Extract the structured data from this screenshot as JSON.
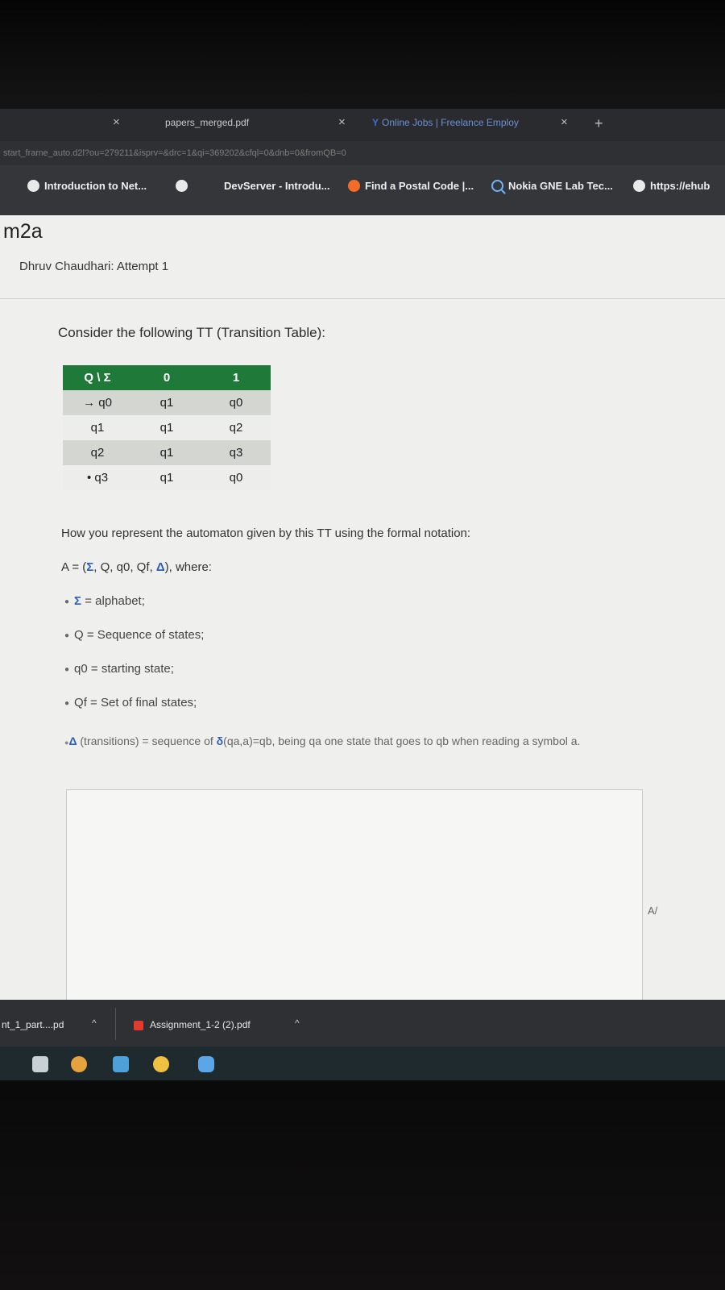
{
  "tabs": {
    "tab1_title": "papers_merged.pdf",
    "tab2_title": "Online Jobs | Freelance Employ",
    "close_glyph": "×",
    "new_tab_glyph": "+"
  },
  "address": {
    "url": "start_frame_auto.d2l?ou=279211&isprv=&drc=1&qi=369202&cfql=0&dnb=0&fromQB=0"
  },
  "bookmarks": [
    {
      "label": "Introduction to Net..."
    },
    {
      "label": "DevServer - Introdu..."
    },
    {
      "label": "Find a Postal Code |..."
    },
    {
      "label": "Nokia GNE Lab Tec..."
    },
    {
      "label": "https://ehub"
    }
  ],
  "page": {
    "course_title": "m2a",
    "attempt_label": "Dhruv Chaudhari: Attempt 1",
    "question_text": "Consider the following TT (Transition Table):",
    "table": {
      "header": [
        "Q \\ Σ",
        "0",
        "1"
      ],
      "rows": [
        [
          "→ q0",
          "q1",
          "q0"
        ],
        [
          "q1",
          "q1",
          "q2"
        ],
        [
          "q2",
          "q1",
          "q3"
        ],
        [
          "• q3",
          "q1",
          "q0"
        ]
      ]
    },
    "prompt": "How you represent the automaton given by this TT using the formal notation:",
    "formal_prefix": "A = (",
    "formal_sigma": "Σ",
    "formal_middle": ", Q, q0, Qf, ",
    "formal_delta": "Δ",
    "formal_suffix": "), where:",
    "definitions": [
      {
        "symbol": "Σ",
        "text": " = alphabet;"
      },
      {
        "symbol": "",
        "text": "Q = Sequence of states;"
      },
      {
        "symbol": "",
        "text": "q0 = starting state;"
      },
      {
        "symbol": "",
        "text": "Qf = Set of final states;"
      }
    ],
    "transition_def": {
      "symbol": "Δ",
      "text_a": " (transitions) = sequence of ",
      "delta": "δ",
      "text_b": "(qa,a)=qb, being qa one state that goes to qb when reading a symbol a."
    }
  },
  "downloads": [
    {
      "label": "nt_1_part....pd"
    },
    {
      "label": "Assignment_1-2 (2).pdf"
    }
  ]
}
